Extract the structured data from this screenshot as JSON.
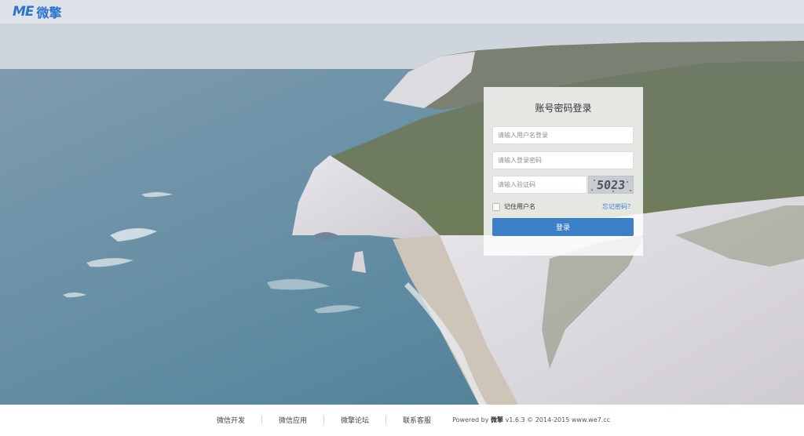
{
  "header": {
    "logo_mark": "ME",
    "logo_text": "微擎"
  },
  "login": {
    "title": "账号密码登录",
    "username_placeholder": "请输入用户名登录",
    "password_placeholder": "请输入登录密码",
    "captcha_placeholder": "请输入验证码",
    "captcha_text": "5023",
    "remember_label": "记住用户名",
    "forgot_label": "忘记密码？",
    "submit_label": "登录"
  },
  "footer": {
    "links": [
      "微信开发",
      "微信应用",
      "微擎论坛",
      "联系客服"
    ],
    "powered_prefix": "Powered by",
    "powered_brand": "微擎",
    "powered_suffix": "v1.6.3 © 2014-2015 www.we7.cc"
  },
  "colors": {
    "brand": "#2a74c9",
    "button": "#3b7fc6",
    "link": "#3c7dc7"
  }
}
